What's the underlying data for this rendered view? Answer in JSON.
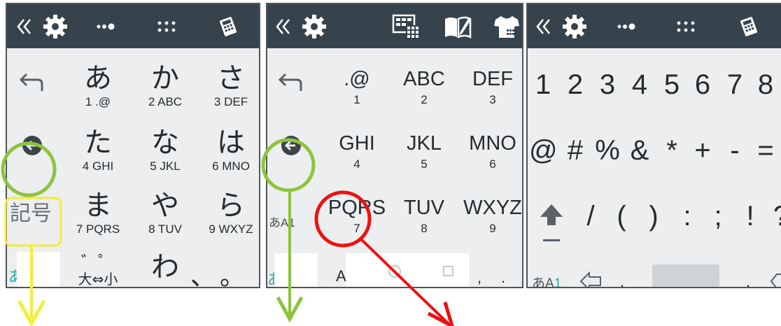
{
  "colors": {
    "toolbar_bg": "#36434d",
    "keyboard_bg": "#eceeef",
    "green_marker": "#8cc43c",
    "yellow_marker": "#f5ec3a",
    "red_marker": "#ee1111",
    "mode_accent": "#2aa9a0"
  },
  "panel1": {
    "toolbar_icons": [
      "collapse-icon",
      "gear-icon",
      "dots-toggle-icon",
      "grid-dots-icon",
      "calculator-icon"
    ],
    "keys": [
      {
        "main": "あ",
        "sub": "1 .@"
      },
      {
        "main": "か",
        "sub": "2 ABC"
      },
      {
        "main": "さ",
        "sub": "3 DEF"
      },
      {
        "main": "た",
        "sub": "4 GHI"
      },
      {
        "main": "な",
        "sub": "5 JKL"
      },
      {
        "main": "は",
        "sub": "6 MNO"
      },
      {
        "main": "ま",
        "sub": "7 PQRS"
      },
      {
        "main": "や",
        "sub": "8 TUV"
      },
      {
        "main": "ら",
        "sub": "9 WXYZ"
      }
    ],
    "bottom_row": {
      "dakuten": "゛゜",
      "dakuten_sub": "大⇔小",
      "wa": "わ",
      "punct": "、。"
    },
    "symbol_key": "記号",
    "mode_fragment": "あ"
  },
  "panel2": {
    "toolbar_icons": [
      "collapse-icon",
      "gear-icon",
      "keypad-grid-icon",
      "dictionary-icon",
      "shirt-icon"
    ],
    "keys": [
      {
        "main": ".@",
        "sub": "1"
      },
      {
        "main": "ABC",
        "sub": "2"
      },
      {
        "main": "DEF",
        "sub": "3"
      },
      {
        "main": "GHI",
        "sub": "4"
      },
      {
        "main": "JKL",
        "sub": "5"
      },
      {
        "main": "MNO",
        "sub": "6"
      },
      {
        "main": "PQRS",
        "sub": "7"
      },
      {
        "main": "TUV",
        "sub": "8"
      },
      {
        "main": "WXYZ",
        "sub": "9"
      }
    ],
    "mode_label": "あA1",
    "bottom_fragments": {
      "left": "あ",
      "a": "A",
      "punct1": ",",
      "punct2": "."
    }
  },
  "panel3": {
    "toolbar_icons": [
      "collapse-icon",
      "gear-icon",
      "dots-toggle-icon",
      "grid-dots-icon",
      "calculator-icon"
    ],
    "row1": [
      "1",
      "2",
      "3",
      "4",
      "5",
      "6",
      "7",
      "8"
    ],
    "row2": [
      "@",
      "#",
      "%",
      "&",
      "*",
      "+",
      "-",
      "="
    ],
    "row3": [
      "/",
      "(",
      ")",
      ":",
      ";",
      "!",
      "?"
    ],
    "mode_label": {
      "main": "あA",
      "accent": "1"
    },
    "bottom_fragments": {
      "dot1": ".",
      "dot2": "."
    }
  }
}
